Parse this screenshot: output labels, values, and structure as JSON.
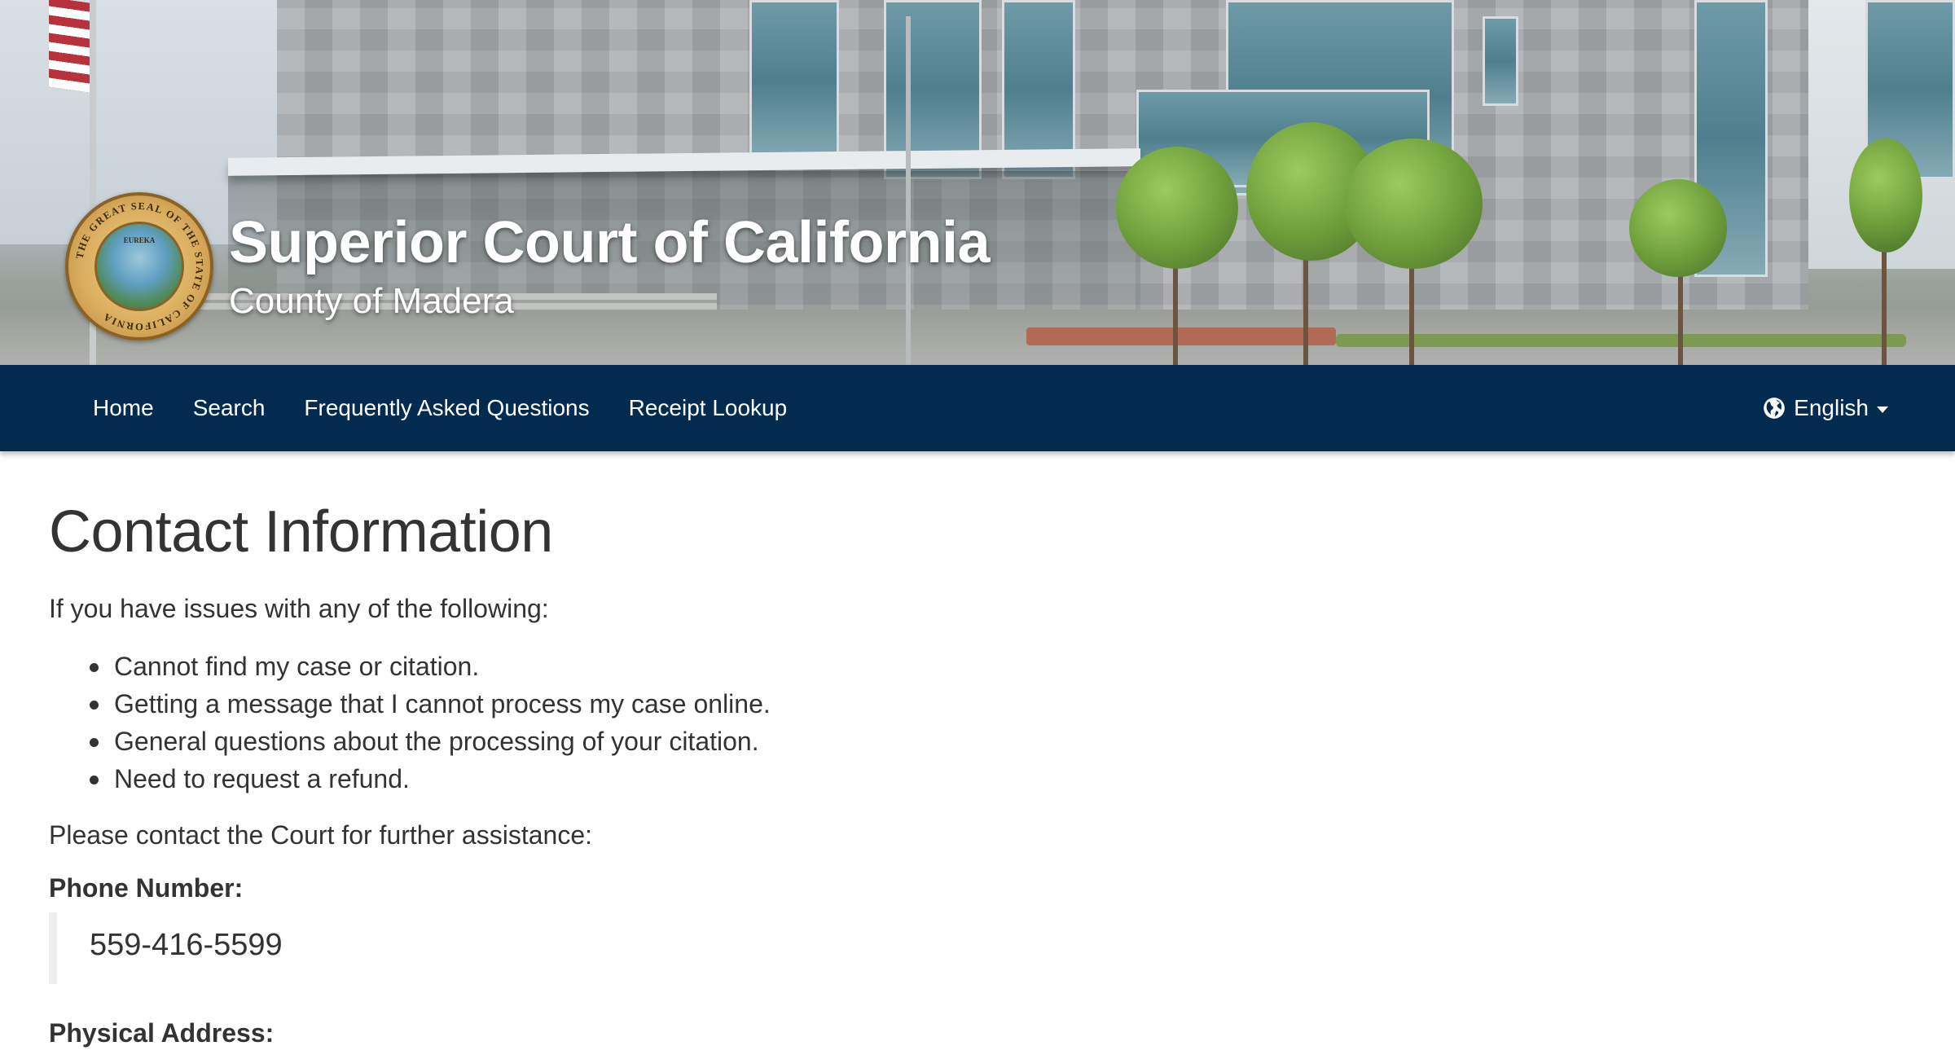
{
  "header": {
    "seal_text": "THE GREAT SEAL OF THE STATE OF CALIFORNIA",
    "seal_motto": "EUREKA",
    "title": "Superior Court of California",
    "subtitle": "County of Madera"
  },
  "nav": {
    "items": [
      {
        "label": "Home"
      },
      {
        "label": "Search"
      },
      {
        "label": "Frequently Asked Questions"
      },
      {
        "label": "Receipt Lookup"
      }
    ],
    "language": {
      "label": "English",
      "icon": "globe-icon"
    }
  },
  "main": {
    "title": "Contact Information",
    "intro": "If you have issues with any of the following:",
    "issues": [
      "Cannot find my case or citation.",
      "Getting a message that I cannot process my case online.",
      "General questions about the processing of your citation.",
      "Need to request a refund."
    ],
    "assist": "Please contact the Court for further assistance:",
    "phone_label": "Phone Number:",
    "phone": "559-416-5599",
    "address_label": "Physical Address:"
  },
  "colors": {
    "navbar": "#032b4f",
    "text": "#333333",
    "quote_border": "#eeeeee"
  }
}
